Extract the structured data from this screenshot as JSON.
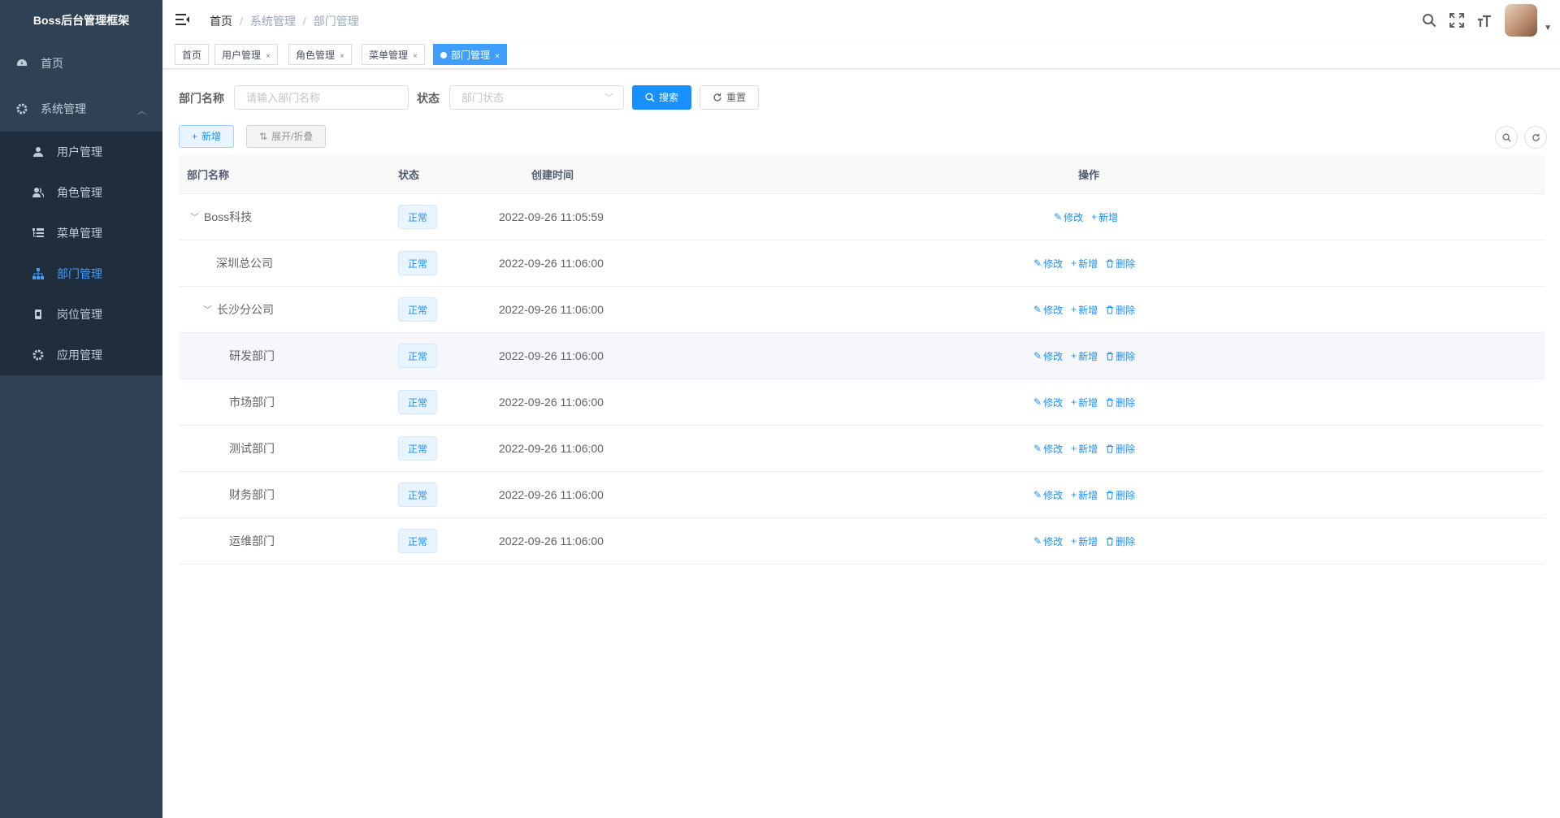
{
  "app": {
    "title": "Boss后台管理框架"
  },
  "sidebar": {
    "items": [
      {
        "label": "首页",
        "icon": "dashboard-icon"
      },
      {
        "label": "系统管理",
        "icon": "gear-icon",
        "expanded": true,
        "children": [
          {
            "label": "用户管理",
            "icon": "user-icon"
          },
          {
            "label": "角色管理",
            "icon": "peoples-icon"
          },
          {
            "label": "菜单管理",
            "icon": "tree-table-icon"
          },
          {
            "label": "部门管理",
            "icon": "tree-icon",
            "active": true
          },
          {
            "label": "岗位管理",
            "icon": "post-icon"
          },
          {
            "label": "应用管理",
            "icon": "gear-icon"
          }
        ]
      }
    ]
  },
  "navbar": {
    "breadcrumb": [
      "首页",
      "系统管理",
      "部门管理"
    ],
    "icons": [
      "search-icon",
      "fullscreen-icon",
      "font-size-icon"
    ]
  },
  "tags": [
    {
      "label": "首页"
    },
    {
      "label": "用户管理"
    },
    {
      "label": "角色管理"
    },
    {
      "label": "菜单管理"
    },
    {
      "label": "部门管理",
      "active": true
    }
  ],
  "search": {
    "dept_name_label": "部门名称",
    "dept_name_placeholder": "请输入部门名称",
    "status_label": "状态",
    "status_placeholder": "部门状态",
    "search_button": "搜索",
    "reset_button": "重置"
  },
  "toolbar": {
    "add_button": "新增",
    "toggle_button": "展开/折叠"
  },
  "table": {
    "columns": [
      "部门名称",
      "状态",
      "创建时间",
      "操作"
    ],
    "rows": [
      {
        "name": "Boss科技",
        "status": "正常",
        "created": "2022-09-26 11:05:59",
        "actions": [
          "修改",
          "新增"
        ]
      },
      {
        "name": "深圳总公司",
        "status": "正常",
        "created": "2022-09-26 11:06:00",
        "actions": [
          "修改",
          "新增",
          "删除"
        ]
      },
      {
        "name": "长沙分公司",
        "status": "正常",
        "created": "2022-09-26 11:06:00",
        "actions": [
          "修改",
          "新增",
          "删除"
        ]
      },
      {
        "name": "研发部门",
        "status": "正常",
        "created": "2022-09-26 11:06:00",
        "actions": [
          "修改",
          "新增",
          "删除"
        ]
      },
      {
        "name": "市场部门",
        "status": "正常",
        "created": "2022-09-26 11:06:00",
        "actions": [
          "修改",
          "新增",
          "删除"
        ]
      },
      {
        "name": "测试部门",
        "status": "正常",
        "created": "2022-09-26 11:06:00",
        "actions": [
          "修改",
          "新增",
          "删除"
        ]
      },
      {
        "name": "财务部门",
        "status": "正常",
        "created": "2022-09-26 11:06:00",
        "actions": [
          "修改",
          "新增",
          "删除"
        ]
      },
      {
        "name": "运维部门",
        "status": "正常",
        "created": "2022-09-26 11:06:00",
        "actions": [
          "修改",
          "新增",
          "删除"
        ]
      }
    ]
  },
  "colors": {
    "sidebar_bg": "#304156",
    "submenu_bg": "#1f2d3d",
    "primary": "#1890ff",
    "active_menu": "#409eff"
  }
}
